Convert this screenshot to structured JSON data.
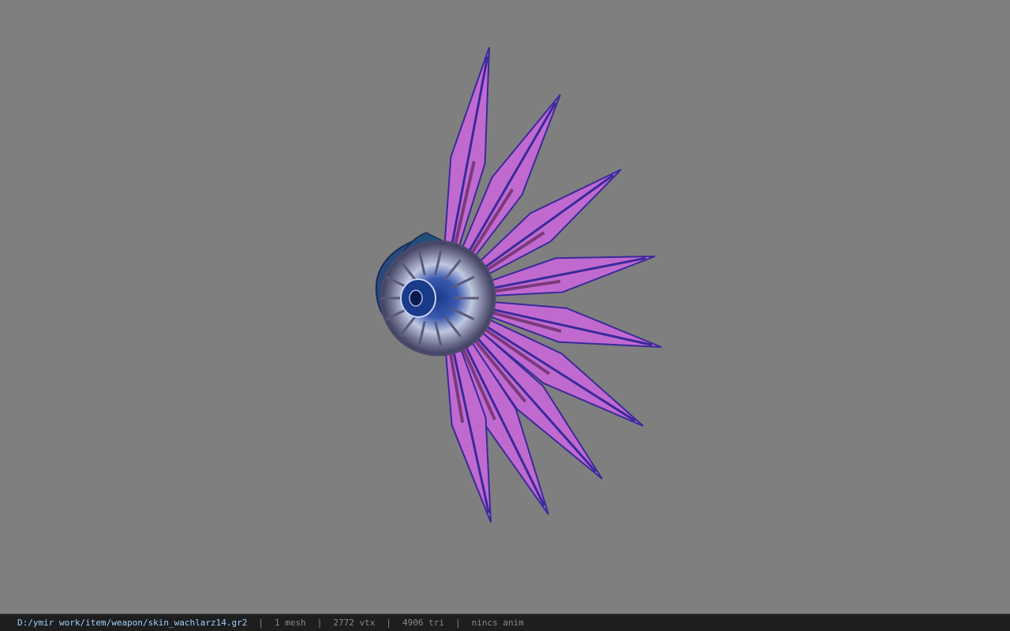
{
  "viewport": {
    "background_color": "#7f7f7f",
    "model": {
      "icon": "fan-weapon-model",
      "colors": {
        "blade": "#c06ad0",
        "blade_edge": "#3a2a9a",
        "blade_rib": "#7a3a7a",
        "hub": "#9aa6c8",
        "hub_core": "#1a3a8a",
        "handle": "#2a4a7a"
      }
    }
  },
  "status_bar": {
    "file_path": "D:/ymir work/item/weapon/skin_wachlarz14.gr2",
    "mesh_count": "1 mesh",
    "vertex_count": "2772 vtx",
    "triangle_count": "4906 tri",
    "anim_status": "nincs anim",
    "separator": "|"
  }
}
